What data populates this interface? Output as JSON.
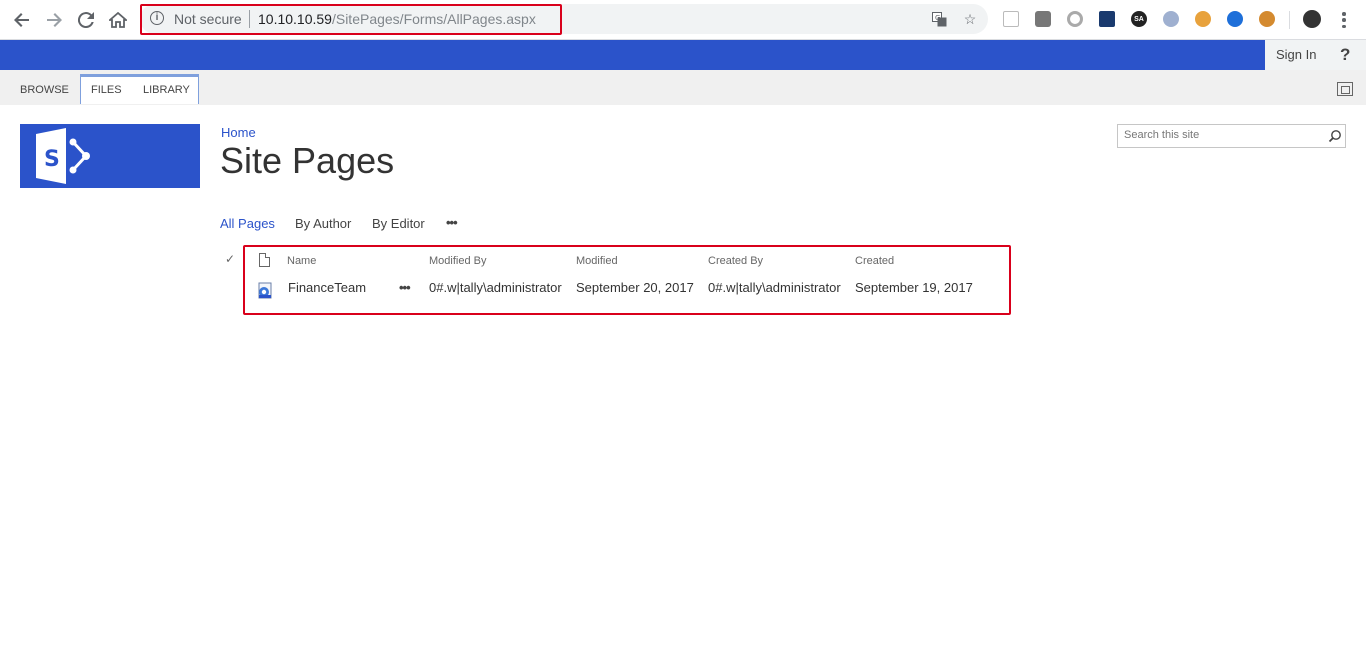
{
  "browser": {
    "not_secure_label": "Not secure",
    "url_host": "10.10.10.59",
    "url_path": "/SitePages/Forms/AllPages.aspx"
  },
  "suite": {
    "sign_in_label": "Sign In",
    "help_label": "?"
  },
  "ribbon": {
    "tabs": [
      {
        "label": "BROWSE"
      },
      {
        "label": "FILES"
      },
      {
        "label": "LIBRARY"
      }
    ]
  },
  "site": {
    "breadcrumb": "Home",
    "title": "Site Pages",
    "search_placeholder": "Search this site"
  },
  "views": {
    "items": [
      {
        "label": "All Pages"
      },
      {
        "label": "By Author"
      },
      {
        "label": "By Editor"
      }
    ],
    "more_label": "•••"
  },
  "list": {
    "columns": [
      "Name",
      "Modified By",
      "Modified",
      "Created By",
      "Created"
    ],
    "rows": [
      {
        "name": "FinanceTeam",
        "modified_by": "0#.w|tally\\administrator",
        "modified": "September 20, 2017",
        "created_by": "0#.w|tally\\administrator",
        "created": "September 19, 2017"
      }
    ],
    "row_menu_label": "•••"
  },
  "colors": {
    "brand_blue": "#2b53ca",
    "highlight_red": "#d9001b"
  },
  "icons": [
    "back-icon",
    "forward-icon",
    "reload-icon",
    "home-icon",
    "info-icon",
    "translate-icon",
    "star-icon",
    "menu-icon",
    "sharepoint-logo",
    "search-icon",
    "checkmark-icon",
    "document-icon",
    "page-icon",
    "focus-icon"
  ]
}
